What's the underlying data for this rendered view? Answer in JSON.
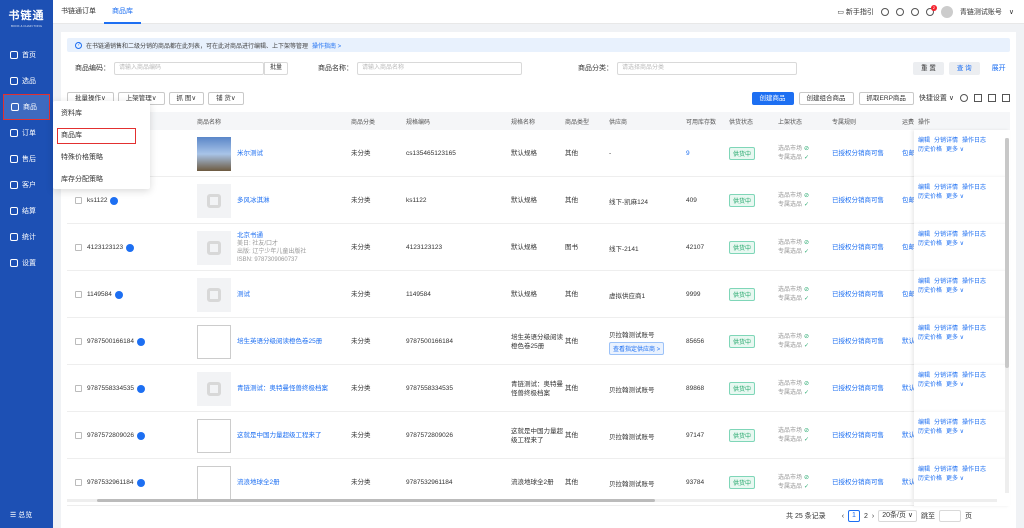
{
  "logo": {
    "title": "书链通",
    "subtitle": "BOOK & CHAIN TONG"
  },
  "sidebar": {
    "items": [
      {
        "label": "首页",
        "icon": "home-icon"
      },
      {
        "label": "选品",
        "icon": "select-icon"
      },
      {
        "label": "商品",
        "icon": "goods-icon"
      },
      {
        "label": "订单",
        "icon": "order-icon"
      },
      {
        "label": "售后",
        "icon": "aftersale-icon"
      },
      {
        "label": "客户",
        "icon": "customer-icon"
      },
      {
        "label": "结算",
        "icon": "settle-icon"
      },
      {
        "label": "统计",
        "icon": "stats-icon"
      },
      {
        "label": "设置",
        "icon": "settings-icon"
      }
    ],
    "collapse": "☰ 总览"
  },
  "topbar": {
    "tabs": [
      "书链通订单",
      "商品库"
    ],
    "guide": "新手指引",
    "badge": "2",
    "account": "青链测试账号"
  },
  "notice": {
    "text": "在书链通销售和二级分销的商品都在此列表，可在此对商品进行编辑、上下架等管理",
    "link": "操作指南 >"
  },
  "filters": {
    "code_label": "商品编码：",
    "code_ph": "请输入商品编码",
    "batch": "批量",
    "name_label": "商品名称：",
    "name_ph": "请输入商品名称",
    "cat_label": "商品分类：",
    "cat_ph": "请选择商品分类",
    "reset": "重 置",
    "query": "查 询",
    "expand": "展开"
  },
  "toolbar": {
    "left": [
      "批量操作",
      "上架管理",
      "抓 图",
      "铺 货"
    ],
    "create": "创建商品",
    "combo": "创建组合商品",
    "erp": "抓取ERP商品",
    "settings": "快捷设置"
  },
  "popup": [
    "资料库",
    "商品库",
    "特殊价格策略",
    "库存分配策略"
  ],
  "columns": [
    "商品名称",
    "商品分类",
    "规格编码",
    "规格名称",
    "商品类型",
    "供应商",
    "可用库存数",
    "供货状态",
    "上架状态",
    "专属规则",
    "运费",
    "操作"
  ],
  "rows": [
    {
      "code": "",
      "title": "米尔测试",
      "cat": "未分类",
      "sku": "cs135465123165",
      "spec": "默认规格",
      "type": "其他",
      "supplier": "-",
      "stock": "9",
      "status": "供货中",
      "s1": "选品市场",
      "s2": "专属选品",
      "rule": "已授权分销商可售",
      "fee": "包邮",
      "thumb": "photo"
    },
    {
      "code": "ks1122",
      "title": "多风冰淇淋",
      "cat": "未分类",
      "sku": "ks1122",
      "spec": "默认规格",
      "type": "其他",
      "supplier": "线下-凯麻124",
      "stock": "409",
      "status": "供货中",
      "s1": "选品市场",
      "s2": "专属选品",
      "rule": "已授权分销商可售",
      "fee": "包邮",
      "thumb": "gray"
    },
    {
      "code": "4123123123",
      "title": "北京书通",
      "sub": "美日: 社友/口才|出版: 辽宁少年儿童出版社|ISBN: 9787309060737",
      "cat": "未分类",
      "sku": "4123123123",
      "spec": "默认规格",
      "type": "图书",
      "supplier": "线下-2141",
      "stock": "42107",
      "status": "供货中",
      "s1": "选品市场",
      "s2": "专属选品",
      "rule": "已授权分销商可售",
      "fee": "包邮",
      "thumb": "gray"
    },
    {
      "code": "1149584",
      "title": "测试",
      "cat": "未分类",
      "sku": "1149584",
      "spec": "默认规格",
      "type": "其他",
      "supplier": "虚拟供应商1",
      "stock": "9999",
      "status": "供货中",
      "s1": "选品市场",
      "s2": "专属选品",
      "rule": "已授权分销商可售",
      "fee": "包邮",
      "thumb": "gray"
    },
    {
      "code": "9787500166184",
      "title": "培生英语分级阅读橙色卷25册",
      "cat": "未分类",
      "sku": "9787500166184",
      "spec": "培生英语分级阅读橙色卷25册",
      "type": "其他",
      "supplier": "贝拉翰测试账号",
      "supplier_tag": "查看指定供应商 >",
      "stock": "85656",
      "status": "供货中",
      "s1": "选品市场",
      "s2": "专属选品",
      "rule": "已授权分销商可售",
      "fee": "默认",
      "thumb": "white"
    },
    {
      "code": "9787558334535",
      "title": "青链测试：奥特曼怪兽终极档案",
      "cat": "未分类",
      "sku": "9787558334535",
      "spec": "青链测试：奥特曼怪兽终极档案",
      "type": "其他",
      "supplier": "贝拉翰测试账号",
      "stock": "89868",
      "status": "供货中",
      "s1": "选品市场",
      "s2": "专属选品",
      "rule": "已授权分销商可售",
      "fee": "默认",
      "thumb": "gray"
    },
    {
      "code": "9787572809026",
      "title": "这就是中国力量超级工程来了",
      "cat": "未分类",
      "sku": "9787572809026",
      "spec": "这就是中国力量超级工程来了",
      "type": "其他",
      "supplier": "贝拉翰测试账号",
      "stock": "97147",
      "status": "供货中",
      "s1": "选品市场",
      "s2": "专属选品",
      "rule": "已授权分销商可售",
      "fee": "默认",
      "thumb": "white"
    },
    {
      "code": "9787532961184",
      "title": "流浪地球全2册",
      "cat": "未分类",
      "sku": "9787532961184",
      "spec": "流浪地球全2册",
      "type": "其他",
      "supplier": "贝拉翰测试账号",
      "stock": "93784",
      "status": "供货中",
      "s1": "选品市场",
      "s2": "专属选品",
      "rule": "已授权分销商可售",
      "fee": "默认",
      "thumb": "white"
    }
  ],
  "ops": {
    "edit": "编辑",
    "detail": "分销详情",
    "log": "操作日志",
    "history": "历史价格",
    "more": "更多 ∨"
  },
  "pager": {
    "total": "共 25 条记录",
    "page1": "1",
    "page2": "2",
    "size": "20条/页",
    "jump": "跳至",
    "unit": "页"
  }
}
